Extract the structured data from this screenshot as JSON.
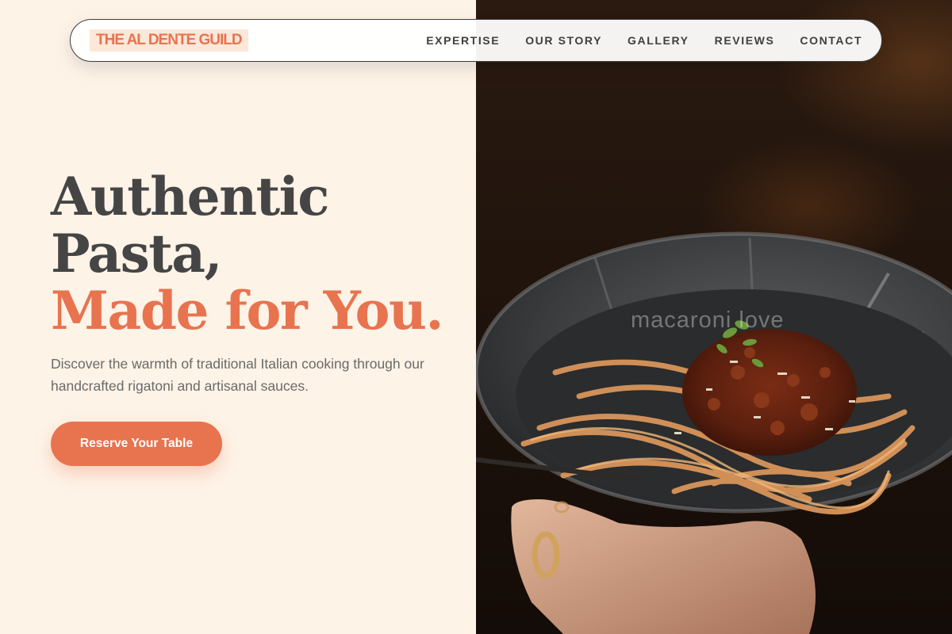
{
  "brand": {
    "logo_text": "THE AL DENTE GUILD"
  },
  "nav": {
    "links": [
      {
        "label": "EXPERTISE"
      },
      {
        "label": "OUR STORY"
      },
      {
        "label": "GALLERY"
      },
      {
        "label": "REVIEWS"
      },
      {
        "label": "CONTACT"
      }
    ]
  },
  "hero": {
    "headline_line1": "Authentic",
    "headline_line2": "Pasta,",
    "headline_accent": "Made for You.",
    "description": "Discover the warmth of traditional Italian cooking through our handcrafted rigatoni and artisanal sauces.",
    "cta_label": "Reserve Your Table"
  },
  "photo": {
    "subject": "hand-holding-pasta-bowl",
    "watermark": "macaroni love"
  },
  "colors": {
    "accent": "#e8734f",
    "background": "#fdf3e7",
    "heading": "#454545",
    "body_text": "#6a6a6a",
    "logo_highlight": "#fbe8d8"
  }
}
